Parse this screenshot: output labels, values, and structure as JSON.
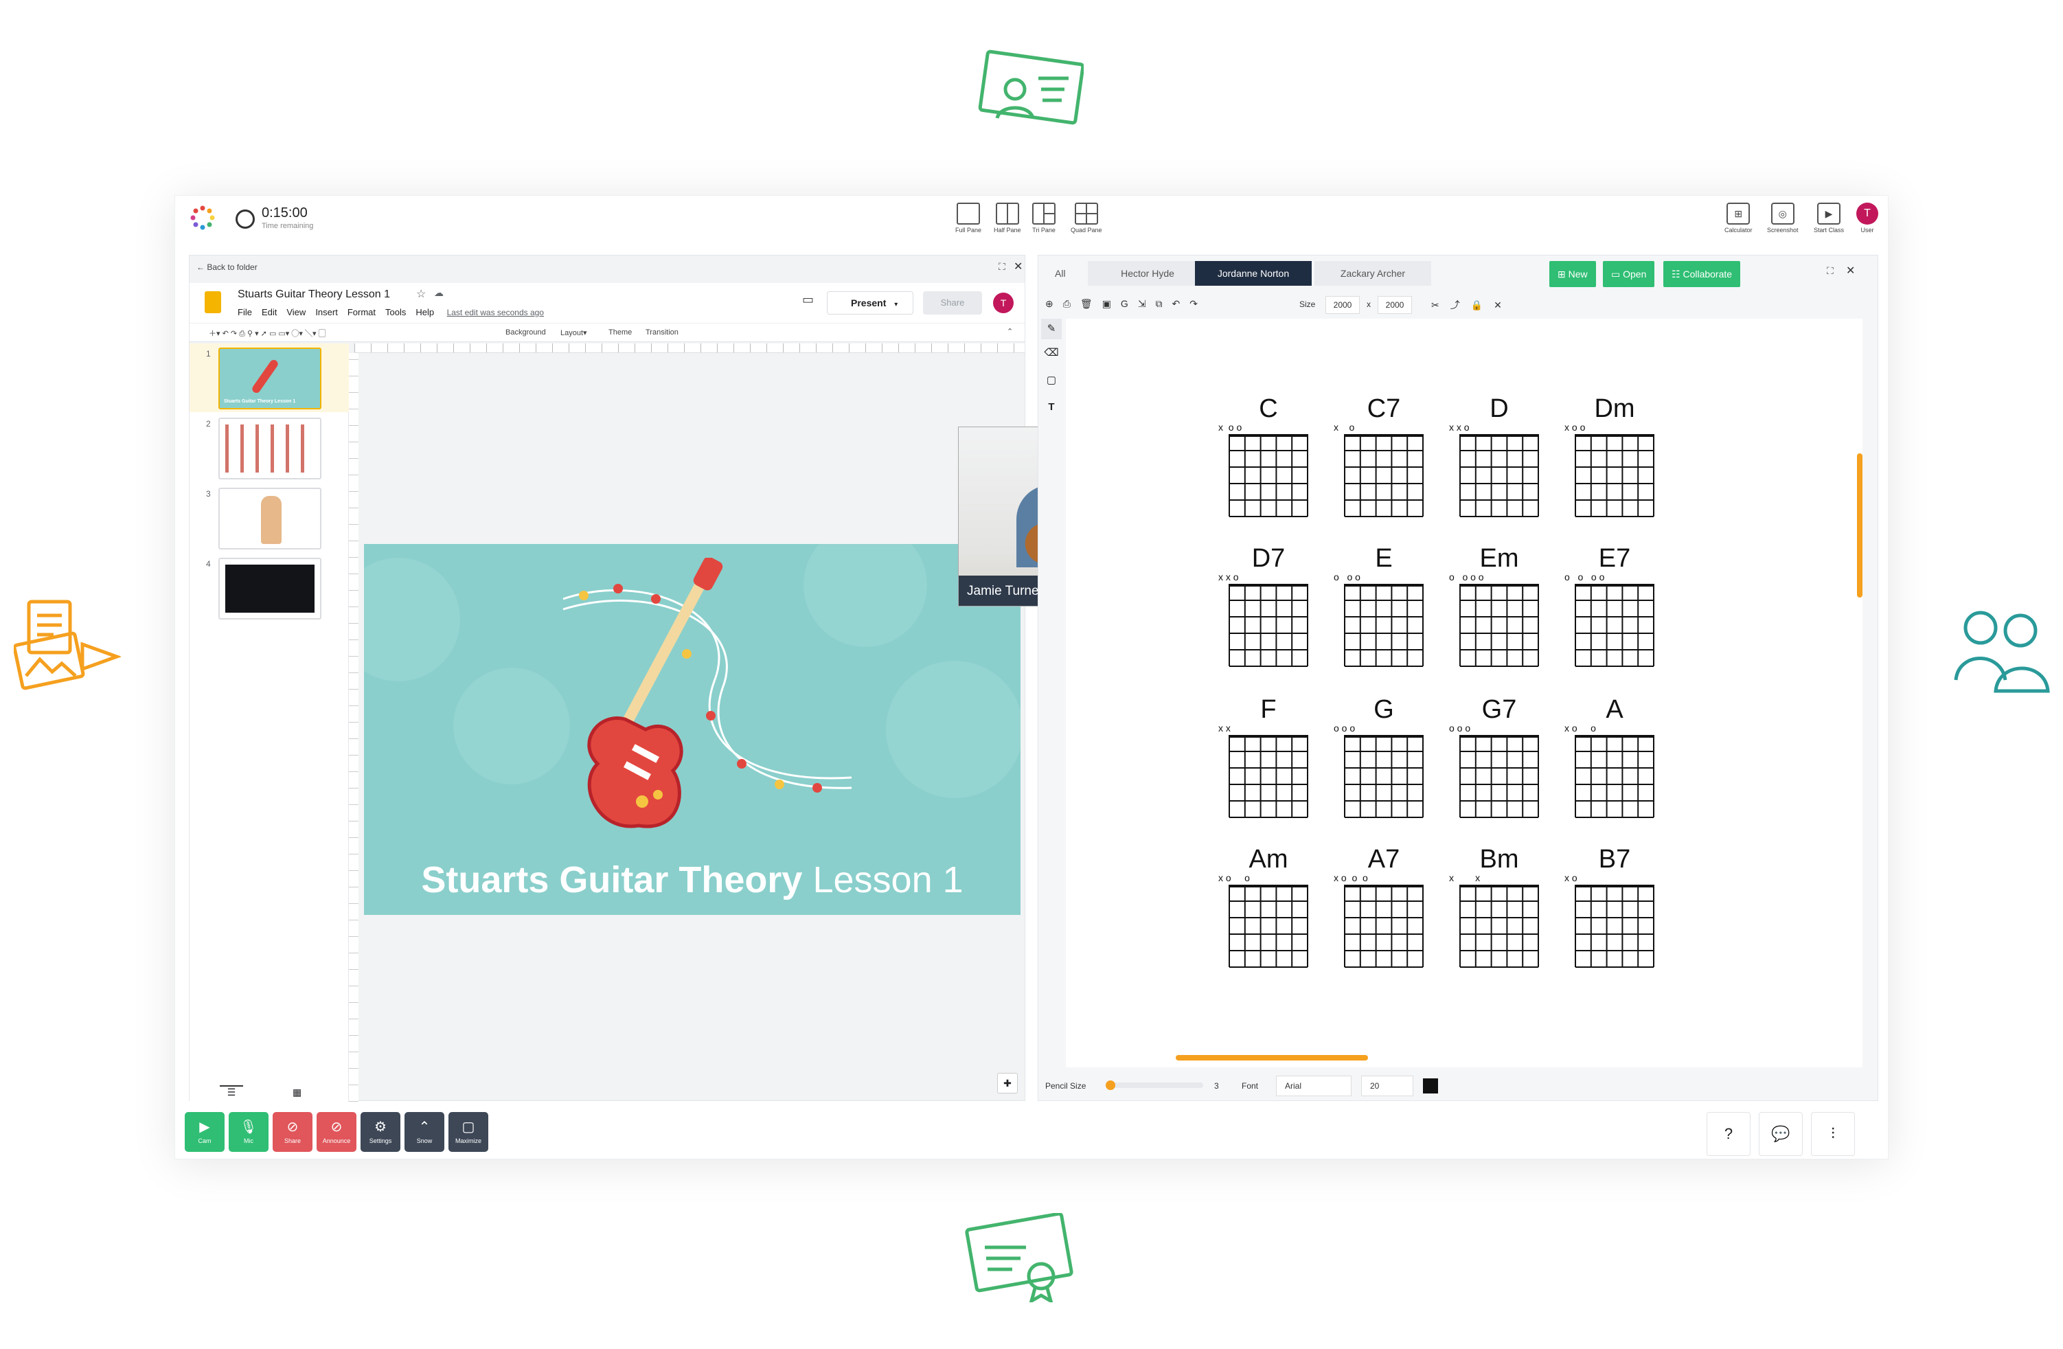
{
  "timer": {
    "value": "0:15:00",
    "label": "Time remaining"
  },
  "layout_buttons": [
    "Full Pane",
    "Half Pane",
    "Tri Pane",
    "Quad Pane"
  ],
  "tools": [
    "Calculator",
    "Screenshot",
    "Start Class",
    "User"
  ],
  "user_initial": "T",
  "slides": {
    "back_label": "Back to folder",
    "doc_title": "Stuarts Guitar Theory Lesson 1",
    "menu": [
      "File",
      "Edit",
      "View",
      "Insert",
      "Format",
      "Tools",
      "Help"
    ],
    "last_edit": "Last edit was seconds ago",
    "present_label": "Present",
    "share_label": "Share",
    "toolbar_items": [
      "Background",
      "Layout▾",
      "Theme",
      "Transition"
    ],
    "thumb_numbers": [
      "1",
      "2",
      "3",
      "4"
    ],
    "thumb1_caption": "Stuarts Guitar Theory Lesson 1",
    "slide_title_bold": "Stuarts Guitar Theory",
    "slide_title_light": "Lesson 1"
  },
  "video": {
    "name": "Jamie Turner"
  },
  "whiteboard": {
    "tabs": [
      "All",
      "Hector Hyde",
      "Jordanne Norton",
      "Zackary Archer"
    ],
    "active_tab": "Jordanne Norton",
    "buttons": {
      "new": "New",
      "open": "Open",
      "collaborate": "Collaborate"
    },
    "size_label": "Size",
    "width": "2000",
    "x_label": "x",
    "height": "2000",
    "pencil_label": "Pencil Size",
    "pencil_value": "3",
    "font_label": "Font",
    "font_value": "Arial",
    "font_size": "20",
    "accent_color": "#f5a01f",
    "ink_color": "#111111"
  },
  "chords": [
    {
      "name": "C",
      "marks": "x  o o"
    },
    {
      "name": "C7",
      "marks": "x    o"
    },
    {
      "name": "D",
      "marks": "x x o"
    },
    {
      "name": "Dm",
      "marks": "x o o"
    },
    {
      "name": "D7",
      "marks": "x x o"
    },
    {
      "name": "E",
      "marks": "o   o o"
    },
    {
      "name": "Em",
      "marks": "o   o o o"
    },
    {
      "name": "E7",
      "marks": "o   o   o o"
    },
    {
      "name": "F",
      "marks": "x x"
    },
    {
      "name": "G",
      "marks": "o o o"
    },
    {
      "name": "G7",
      "marks": "o o o"
    },
    {
      "name": "A",
      "marks": "x o     o"
    },
    {
      "name": "Am",
      "marks": "x o     o"
    },
    {
      "name": "A7",
      "marks": "x o  o  o"
    },
    {
      "name": "Bm",
      "marks": "x        x"
    },
    {
      "name": "B7",
      "marks": "x o"
    }
  ],
  "controls": [
    "Cam",
    "Mic",
    "Share",
    "Announce",
    "Settings",
    "Snow",
    "Maximize"
  ],
  "colors": {
    "green": "#2fbe73",
    "red": "#e0565b",
    "slate": "#3d4756",
    "navy": "#1f2d42",
    "teal": "#8acfcc"
  }
}
